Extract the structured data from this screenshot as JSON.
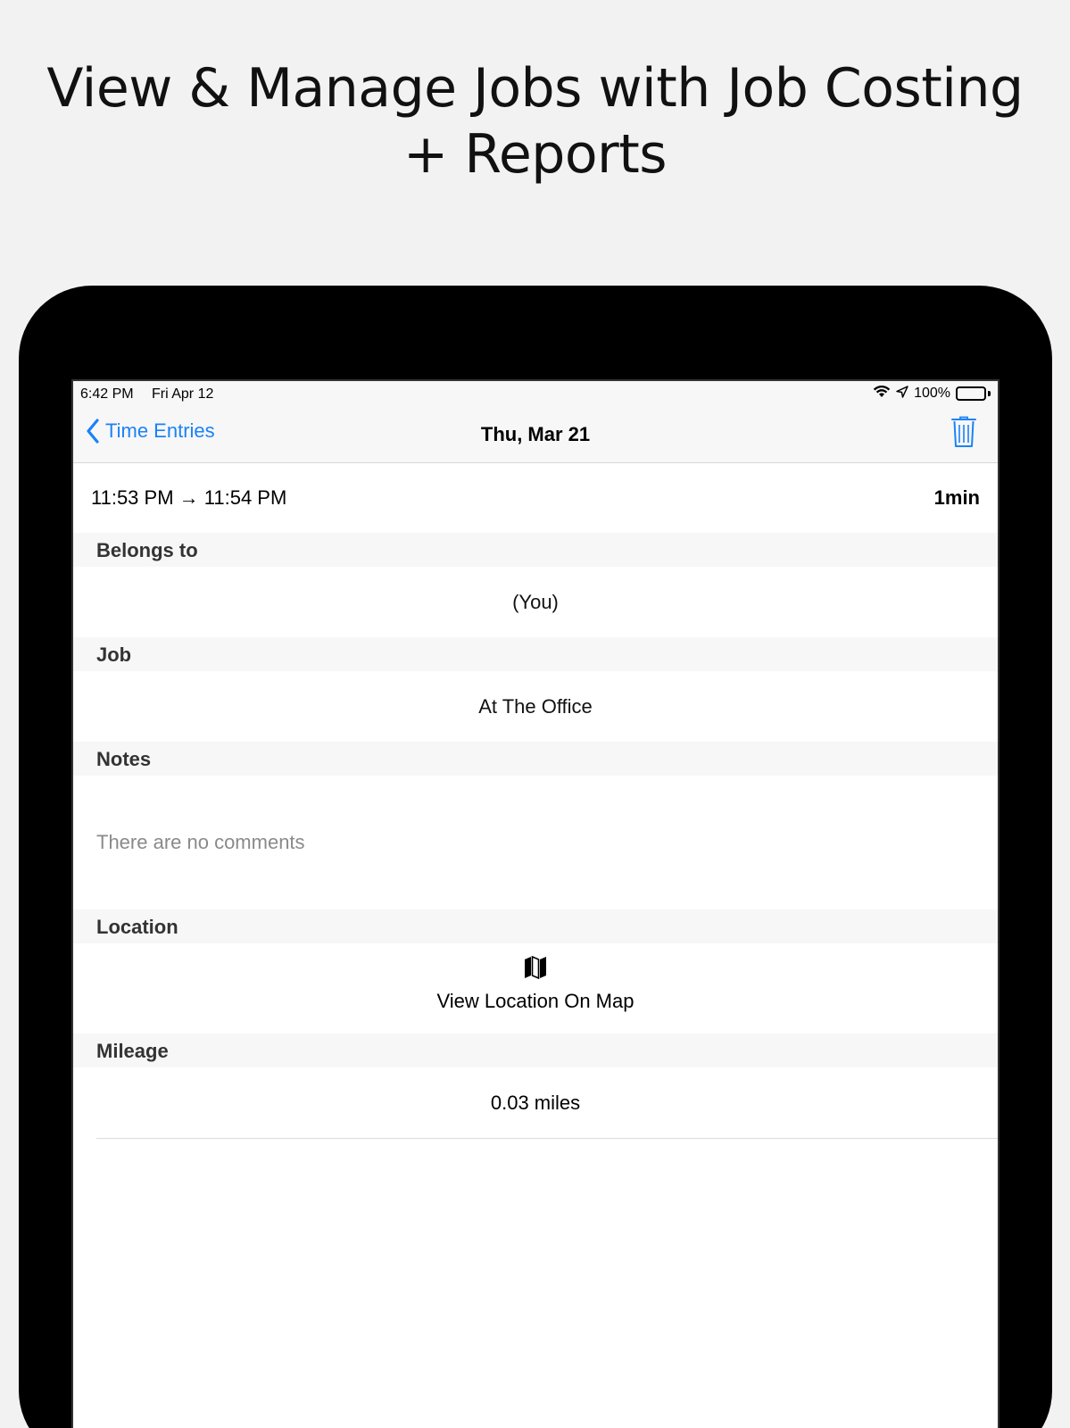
{
  "headline": "View & Manage Jobs with Job Costing + Reports",
  "status_bar": {
    "time": "6:42 PM",
    "date": "Fri Apr 12",
    "battery": "100%"
  },
  "nav": {
    "back_label": "Time Entries",
    "title": "Thu, Mar 21",
    "accent_color": "#1a82f7"
  },
  "entry": {
    "time_range": "11:53 PM → 11:54 PM",
    "duration": "1min"
  },
  "sections": {
    "belongs_to": {
      "header": "Belongs to",
      "value": "(You)"
    },
    "job": {
      "header": "Job",
      "value": "At The Office"
    },
    "notes": {
      "header": "Notes",
      "placeholder": "There are no comments"
    },
    "location": {
      "header": "Location",
      "action_label": "View Location On Map",
      "icon": "map-icon"
    },
    "mileage": {
      "header": "Mileage",
      "value": "0.03 miles"
    }
  }
}
